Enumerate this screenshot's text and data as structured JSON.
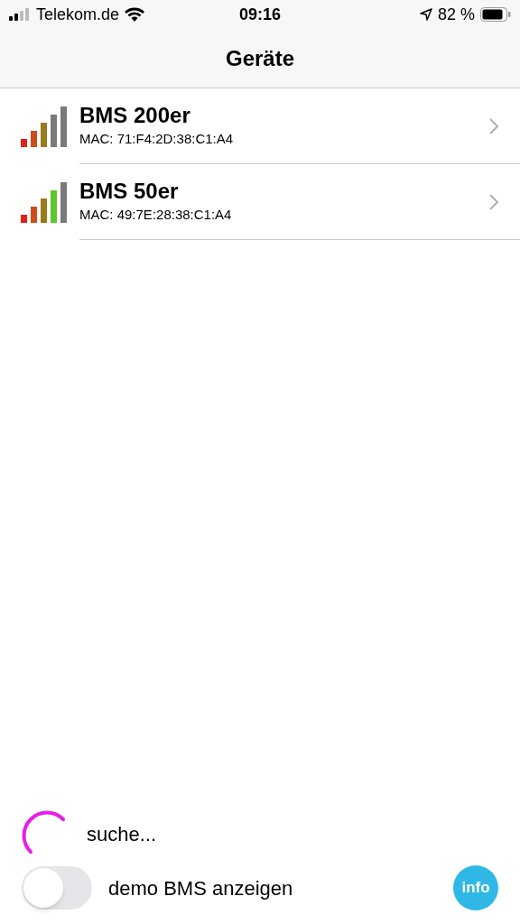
{
  "status_bar": {
    "carrier": "Telekom.de",
    "time": "09:16",
    "battery": "82 %"
  },
  "nav": {
    "title": "Geräte"
  },
  "devices": [
    {
      "name": "BMS 200er",
      "mac": "MAC: 71:F4:2D:38:C1:A4",
      "level": 0.6
    },
    {
      "name": "BMS 50er",
      "mac": "MAC: 49:7E:28:38:C1:A4",
      "level": 0.8
    }
  ],
  "search_status": "suche...",
  "demo_toggle": {
    "label": "demo BMS anzeigen",
    "on": false
  },
  "info_button": "info"
}
